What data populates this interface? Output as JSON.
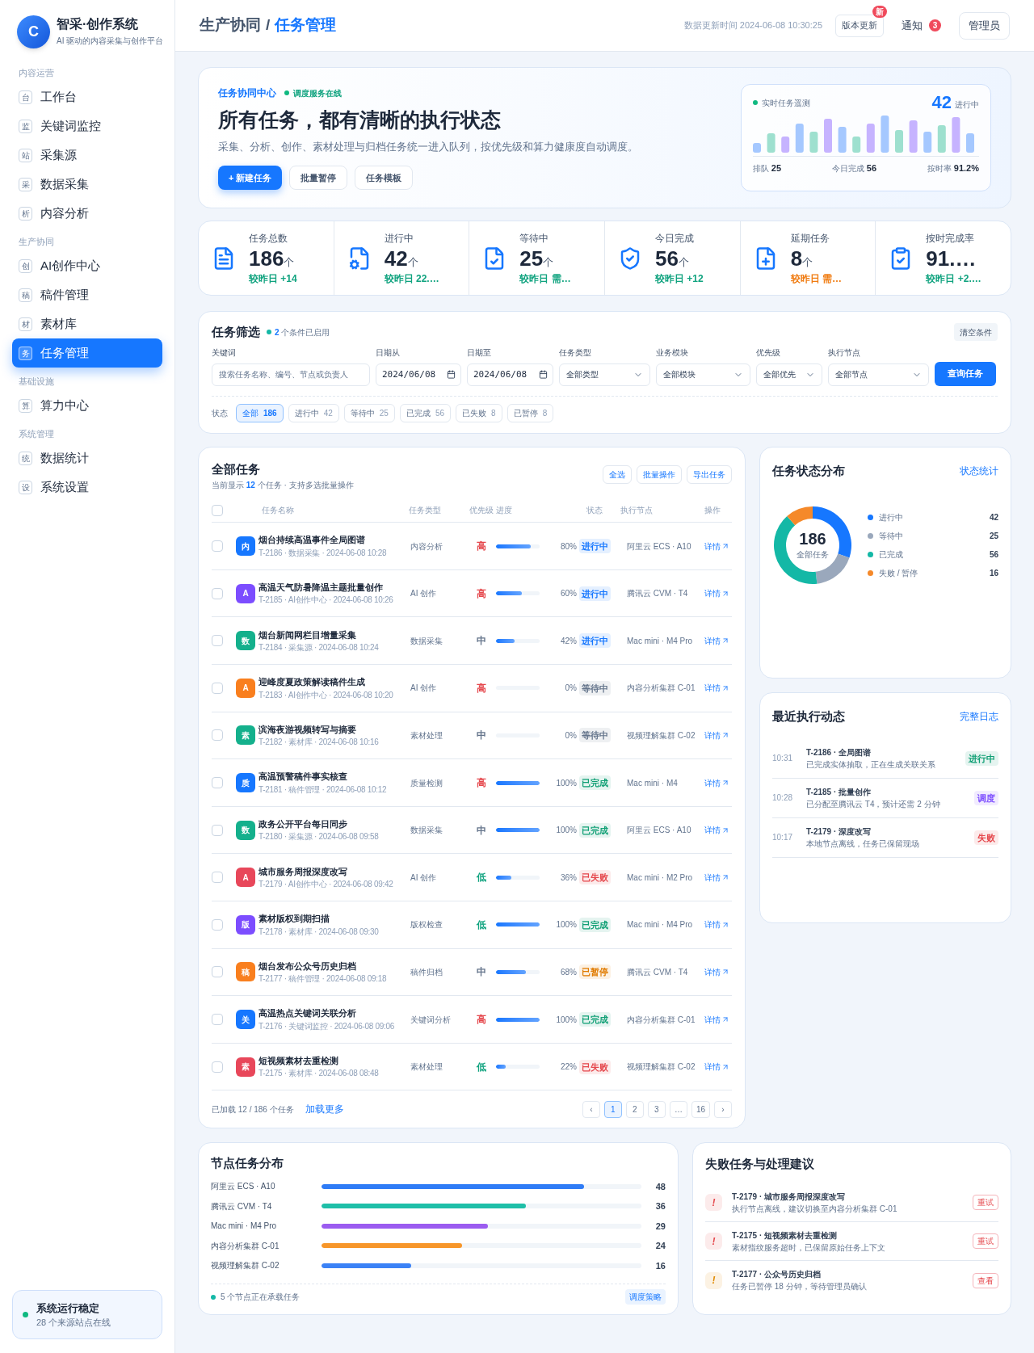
{
  "brand": {
    "logo_letter": "C",
    "title": "智采·创作系统",
    "subtitle": "AI 驱动的内容采集与创作平台"
  },
  "sidebar": {
    "groups": [
      {
        "label": "内容运营",
        "items": [
          {
            "badge": "台",
            "label": "工作台",
            "selected": false
          },
          {
            "badge": "监",
            "label": "关键词监控",
            "selected": false
          },
          {
            "badge": "站",
            "label": "采集源",
            "selected": false
          },
          {
            "badge": "采",
            "label": "数据采集",
            "selected": false
          },
          {
            "badge": "析",
            "label": "内容分析",
            "selected": false
          }
        ]
      },
      {
        "label": "生产协同",
        "items": [
          {
            "badge": "创",
            "label": "AI创作中心",
            "selected": false
          },
          {
            "badge": "稿",
            "label": "稿件管理",
            "selected": false
          },
          {
            "badge": "材",
            "label": "素材库",
            "selected": false
          },
          {
            "badge": "务",
            "label": "任务管理",
            "selected": true
          }
        ]
      },
      {
        "label": "基础设施",
        "items": [
          {
            "badge": "算",
            "label": "算力中心",
            "selected": false
          }
        ]
      },
      {
        "label": "系统管理",
        "items": [
          {
            "badge": "统",
            "label": "数据统计",
            "selected": false
          },
          {
            "badge": "设",
            "label": "系统设置",
            "selected": false
          }
        ]
      }
    ],
    "status": {
      "title": "系统运行稳定",
      "subtitle": "28 个来源站点在线"
    }
  },
  "header": {
    "breadcrumb": [
      "生产协同",
      "/",
      "任务管理"
    ],
    "updated": "数据更新时间 2024-06-08 10:30:25",
    "version_button": "版本更新",
    "version_badge": "新",
    "notify": "通知",
    "notify_count": "3",
    "user": "管理员"
  },
  "hero": {
    "eyebrow": "任务协同中心",
    "service_status": "调度服务在线",
    "title": "所有任务，都有清晰的执行状态",
    "description": "采集、分析、创作、素材处理与归档任务统一进入队列，按优先级和算力健康度自动调度。",
    "buttons": [
      {
        "label": "+ 新建任务",
        "primary": true
      },
      {
        "label": "批量暂停",
        "primary": false
      },
      {
        "label": "任务模板",
        "primary": false
      }
    ],
    "telemetry": {
      "title": "实时任务遥测",
      "value": "42",
      "unit": "进行中",
      "footer": [
        "排队 **25**",
        "今日完成 **56**",
        "按时率 **91.2%**"
      ]
    }
  },
  "stats": [
    {
      "label": "任务总数",
      "value": "186",
      "unit": "个",
      "delta": {
        "text": "较昨日 +14",
        "color": "#10a37f"
      }
    },
    {
      "label": "进行中",
      "value": "42",
      "unit": "个",
      "delta": {
        "text": "较昨日 22.…",
        "color": "#10a37f"
      }
    },
    {
      "label": "等待中",
      "value": "25",
      "unit": "个",
      "delta": {
        "text": "较昨日 需…",
        "color": "#10a37f"
      }
    },
    {
      "label": "今日完成",
      "value": "56",
      "unit": "个",
      "delta": {
        "text": "较昨日 +12",
        "color": "#10a37f"
      }
    },
    {
      "label": "延期任务",
      "value": "8",
      "unit": "个",
      "delta": {
        "text": "较昨日 需…",
        "color": "#f07c12"
      }
    },
    {
      "label": "按时完成率",
      "value": "91.…",
      "delta": {
        "text": "较昨日 +2.…",
        "color": "#10a37f"
      }
    }
  ],
  "filter": {
    "title": "任务筛选",
    "active": "**2** 个条件已启用",
    "clear": "清空条件",
    "keyword": {
      "label": "关键词",
      "placeholder": "搜索任务名称、编号、节点或负责人"
    },
    "date_from": {
      "label": "日期从",
      "value": "2024/06/08"
    },
    "date_to": {
      "label": "日期至",
      "value": "2024/06/08"
    },
    "selects": [
      {
        "label": "任务类型",
        "value": "全部类型"
      },
      {
        "label": "业务模块",
        "value": "全部模块"
      },
      {
        "label": "优先级",
        "value": "全部优先"
      },
      {
        "label": "执行节点",
        "value": "全部节点"
      }
    ],
    "submit": "查询任务",
    "status_label": "状态",
    "chips": [
      {
        "label": "全部",
        "count": "186",
        "selected": true
      },
      {
        "label": "进行中",
        "count": "42",
        "selected": false
      },
      {
        "label": "等待中",
        "count": "25",
        "selected": false
      },
      {
        "label": "已完成",
        "count": "56",
        "selected": false
      },
      {
        "label": "已失败",
        "count": "8",
        "selected": false
      },
      {
        "label": "已暂停",
        "count": "8",
        "selected": false
      }
    ]
  },
  "tasks": {
    "title": "全部任务",
    "subtitle": "当前显示 **12** 个任务 · 支持多选批量操作",
    "actions": [
      "全选",
      "批量操作",
      "导出任务"
    ],
    "select_all_checked": false,
    "columns": [
      "任务名称",
      "任务类型",
      "优先级",
      "进度",
      "状态",
      "执行节点",
      "操作"
    ],
    "rows": [
      {
        "avatar": {
          "text": "内",
          "color": "#1677ff"
        },
        "name": "烟台持续高温事件全局图谱",
        "meta": "T-2186 · 数据采集 · 2024-06-08 10:28",
        "type": "内容分析",
        "priority": {
          "text": "高",
          "color": "#e5484d"
        },
        "level": 0.8,
        "percent": "80%",
        "status": {
          "text": "进行中",
          "color": "#1677ff"
        },
        "node": "阿里云 ECS · A10",
        "action": "详情",
        "checked": false
      },
      {
        "avatar": {
          "text": "A",
          "color": "#7c4dff"
        },
        "name": "高温天气防暑降温主题批量创作",
        "meta": "T-2185 · AI创作中心 · 2024-06-08 10:26",
        "type": "AI 创作",
        "priority": {
          "text": "高",
          "color": "#e5484d"
        },
        "level": 0.6,
        "percent": "60%",
        "status": {
          "text": "进行中",
          "color": "#1677ff"
        },
        "node": "腾讯云 CVM · T4",
        "action": "详情",
        "checked": false
      },
      {
        "avatar": {
          "text": "数",
          "color": "#14b08c"
        },
        "name": "烟台新闻网栏目增量采集",
        "meta": "T-2184 · 采集源 · 2024-06-08 10:24",
        "type": "数据采集",
        "priority": {
          "text": "中",
          "color": "#64748b"
        },
        "level": 0.42,
        "percent": "42%",
        "status": {
          "text": "进行中",
          "color": "#1677ff"
        },
        "node": "Mac mini · M4 Pro",
        "action": "详情",
        "checked": false
      },
      {
        "avatar": {
          "text": "A",
          "color": "#f97f1e"
        },
        "name": "迎峰度夏政策解读稿件生成",
        "meta": "T-2183 · AI创作中心 · 2024-06-08 10:20",
        "type": "AI 创作",
        "priority": {
          "text": "高",
          "color": "#e5484d"
        },
        "level": 0,
        "percent": "0%",
        "status": {
          "text": "等待中",
          "color": "#64748b"
        },
        "node": "内容分析集群 C-01",
        "action": "详情",
        "checked": false
      },
      {
        "avatar": {
          "text": "素",
          "color": "#14b08c"
        },
        "name": "滨海夜游视频转写与摘要",
        "meta": "T-2182 · 素材库 · 2024-06-08 10:16",
        "type": "素材处理",
        "priority": {
          "text": "中",
          "color": "#64748b"
        },
        "level": 0,
        "percent": "0%",
        "status": {
          "text": "等待中",
          "color": "#64748b"
        },
        "node": "视频理解集群 C-02",
        "action": "详情",
        "checked": false
      },
      {
        "avatar": {
          "text": "质",
          "color": "#1677ff"
        },
        "name": "高温预警稿件事实核查",
        "meta": "T-2181 · 稿件管理 · 2024-06-08 10:12",
        "type": "质量检测",
        "priority": {
          "text": "高",
          "color": "#e5484d"
        },
        "level": 1,
        "percent": "100%",
        "status": {
          "text": "已完成",
          "color": "#0f9f74"
        },
        "node": "Mac mini · M4",
        "action": "详情",
        "checked": false
      },
      {
        "avatar": {
          "text": "数",
          "color": "#14b08c"
        },
        "name": "政务公开平台每日同步",
        "meta": "T-2180 · 采集源 · 2024-06-08 09:58",
        "type": "数据采集",
        "priority": {
          "text": "中",
          "color": "#64748b"
        },
        "level": 1,
        "percent": "100%",
        "status": {
          "text": "已完成",
          "color": "#0f9f74"
        },
        "node": "阿里云 ECS · A10",
        "action": "详情",
        "checked": false
      },
      {
        "avatar": {
          "text": "A",
          "color": "#e8475a"
        },
        "name": "城市服务周报深度改写",
        "meta": "T-2179 · AI创作中心 · 2024-06-08 09:42",
        "type": "AI 创作",
        "priority": {
          "text": "低",
          "color": "#10a37f"
        },
        "level": 0.36,
        "percent": "36%",
        "status": {
          "text": "已失败",
          "color": "#e5484d"
        },
        "node": "Mac mini · M2 Pro",
        "action": "详情",
        "checked": false
      },
      {
        "avatar": {
          "text": "版",
          "color": "#7c4dff"
        },
        "name": "素材版权到期扫描",
        "meta": "T-2178 · 素材库 · 2024-06-08 09:30",
        "type": "版权检查",
        "priority": {
          "text": "低",
          "color": "#10a37f"
        },
        "level": 1,
        "percent": "100%",
        "status": {
          "text": "已完成",
          "color": "#0f9f74"
        },
        "node": "Mac mini · M4 Pro",
        "action": "详情",
        "checked": false
      },
      {
        "avatar": {
          "text": "稿",
          "color": "#f97f1e"
        },
        "name": "烟台发布公众号历史归档",
        "meta": "T-2177 · 稿件管理 · 2024-06-08 09:18",
        "type": "稿件归档",
        "priority": {
          "text": "中",
          "color": "#64748b"
        },
        "level": 0.68,
        "percent": "68%",
        "status": {
          "text": "已暂停",
          "color": "#e07b00"
        },
        "node": "腾讯云 CVM · T4",
        "action": "详情",
        "checked": false
      },
      {
        "avatar": {
          "text": "关",
          "color": "#1677ff"
        },
        "name": "高温热点关键词关联分析",
        "meta": "T-2176 · 关键词监控 · 2024-06-08 09:06",
        "type": "关键词分析",
        "priority": {
          "text": "高",
          "color": "#e5484d"
        },
        "level": 1,
        "percent": "100%",
        "status": {
          "text": "已完成",
          "color": "#0f9f74"
        },
        "node": "内容分析集群 C-01",
        "action": "详情",
        "checked": false
      },
      {
        "avatar": {
          "text": "素",
          "color": "#e8475a"
        },
        "name": "短视频素材去重检测",
        "meta": "T-2175 · 素材库 · 2024-06-08 08:48",
        "type": "素材处理",
        "priority": {
          "text": "低",
          "color": "#10a37f"
        },
        "level": 0.22,
        "percent": "22%",
        "status": {
          "text": "已失败",
          "color": "#e5484d"
        },
        "node": "视频理解集群 C-02",
        "action": "详情",
        "checked": false
      }
    ],
    "loaded": "已加载 12 / 186 个任务",
    "load_more": "加载更多",
    "pages": [
      {
        "label": "‹",
        "selected": false
      },
      {
        "label": "1",
        "selected": true
      },
      {
        "label": "2",
        "selected": false
      },
      {
        "label": "3",
        "selected": false
      },
      {
        "label": "…",
        "selected": false
      },
      {
        "label": "16",
        "selected": false
      },
      {
        "label": "›",
        "selected": false
      }
    ]
  },
  "status_distribution": {
    "title": "任务状态分布",
    "link": "状态统计",
    "center_value": "186",
    "center_label": "全部任务",
    "chart_data": {
      "type": "donut",
      "categories": [
        "进行中",
        "等待中",
        "已完成",
        "失败 / 暂停"
      ],
      "series": [
        {
          "values": [
            30.2,
            18,
            40.3,
            11.5
          ]
        }
      ]
    },
    "legend": [
      {
        "value": "42",
        "color": "#1677ff"
      },
      {
        "value": "25",
        "color": "#9aa8bc"
      },
      {
        "value": "56",
        "color": "#14b8a6"
      },
      {
        "value": "16",
        "color": "#f5892a"
      }
    ]
  },
  "recent": {
    "title": "最近执行动态",
    "link": "完整日志",
    "items": [
      {
        "time": "10:31",
        "title": "T-2186 · 全局图谱",
        "desc": "已完成实体抽取，正在生成关联关系",
        "tag": {
          "text": "进行中",
          "color": "#0f9f74"
        }
      },
      {
        "time": "10:28",
        "title": "T-2185 · 批量创作",
        "desc": "已分配至腾讯云 T4，预计还需 2 分钟",
        "tag": {
          "text": "调度",
          "color": "#7c4dff"
        }
      },
      {
        "time": "10:17",
        "title": "T-2179 · 深度改写",
        "desc": "本地节点离线，任务已保留现场",
        "tag": {
          "text": "失败",
          "color": "#e5484d"
        }
      }
    ]
  },
  "nodes": {
    "title": "节点任务分布",
    "items": [
      {
        "label": "阿里云 ECS · A10",
        "level": 0.82,
        "value": "48",
        "color": "#2f7cf6"
      },
      {
        "label": "腾讯云 CVM · T4",
        "level": 0.64,
        "value": "36",
        "color": "#1fbfa8"
      },
      {
        "label": "Mac mini · M4 Pro",
        "level": 0.52,
        "value": "29",
        "color": "#9b5cf0"
      },
      {
        "label": "内容分析集群 C-01",
        "level": 0.44,
        "value": "24",
        "color": "#f7962a"
      },
      {
        "label": "视频理解集群 C-02",
        "level": 0.28,
        "value": "16",
        "color": "#3b82f6"
      }
    ],
    "footer": "5 个节点正在承载任务",
    "button": "调度策略"
  },
  "failures": {
    "title": "失败任务与处理建议",
    "items": [
      {
        "mark": {
          "text": "!",
          "color": "#e5484d"
        },
        "title": "T-2179 · 城市服务周报深度改写",
        "desc": "执行节点离线，建议切换至内容分析集群 C-01",
        "action": "重试"
      },
      {
        "mark": {
          "text": "!",
          "color": "#e5484d"
        },
        "title": "T-2175 · 短视频素材去重检测",
        "desc": "素材指纹服务超时，已保留原始任务上下文",
        "action": "重试"
      },
      {
        "mark": {
          "text": "!",
          "color": "#e08a00"
        },
        "title": "T-2177 · 公众号历史归档",
        "desc": "任务已暂停 18 分钟，等待管理员确认",
        "action": "查看"
      }
    ]
  }
}
